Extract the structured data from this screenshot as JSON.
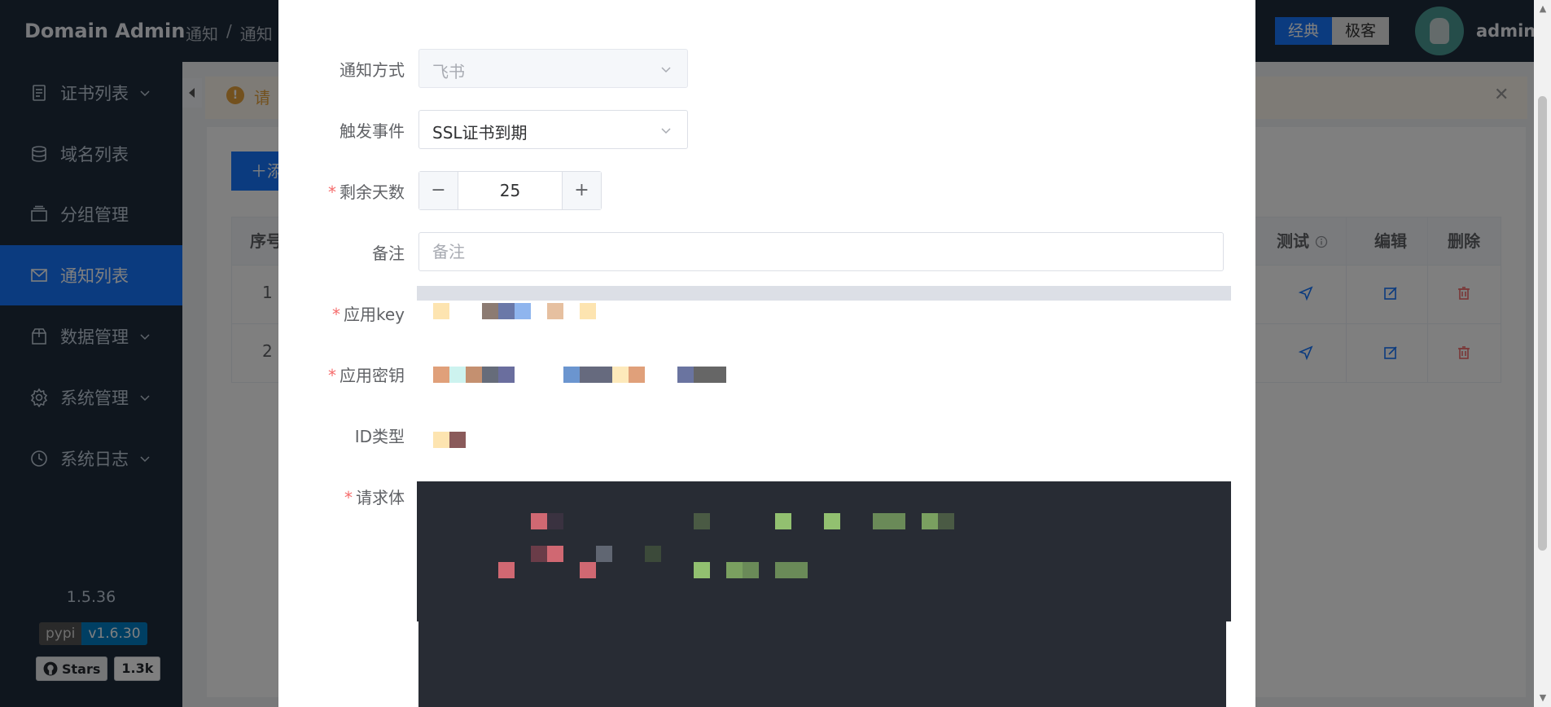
{
  "header": {
    "brand": "Domain Admin",
    "breadcrumb": [
      "通知",
      "/",
      "通知"
    ],
    "modes": [
      "经典",
      "极客"
    ],
    "username": "admin"
  },
  "sidebar": {
    "items": [
      {
        "label": "证书列表",
        "icon": "document-icon",
        "has_children": true
      },
      {
        "label": "域名列表",
        "icon": "database-icon",
        "has_children": false
      },
      {
        "label": "分组管理",
        "icon": "folder-icon",
        "has_children": false
      },
      {
        "label": "通知列表",
        "icon": "mail-icon",
        "has_children": false,
        "active": true
      },
      {
        "label": "数据管理",
        "icon": "box-icon",
        "has_children": true
      },
      {
        "label": "系统管理",
        "icon": "gear-icon",
        "has_children": true
      },
      {
        "label": "系统日志",
        "icon": "clock-icon",
        "has_children": true
      }
    ],
    "version": "1.5.36",
    "pypi_label": "pypi",
    "pypi_version": "v1.6.30",
    "github_label": "Stars",
    "github_count": "1.3k"
  },
  "background": {
    "alert_text": "请",
    "add_button": "＋添",
    "table_headers": {
      "index": "序号",
      "test": "测试",
      "edit": "编辑",
      "delete": "删除"
    },
    "rows": [
      {
        "index": "1"
      },
      {
        "index": "2"
      }
    ]
  },
  "dialog": {
    "fields": {
      "notify_method": {
        "label": "通知方式",
        "value": "飞书"
      },
      "trigger_event": {
        "label": "触发事件",
        "value": "SSL证书到期"
      },
      "remaining_days": {
        "label": "剩余天数",
        "value": "25"
      },
      "remark": {
        "label": "备注",
        "placeholder": "备注"
      },
      "app_key": {
        "label": "应用key"
      },
      "app_secret": {
        "label": "应用密钥"
      },
      "id_type": {
        "label": "ID类型"
      },
      "request_body": {
        "label": "请求体"
      }
    }
  },
  "colors": {
    "primary": "#1677ff",
    "sidebar_bg": "#1f2d3d",
    "required": "#f56c6c",
    "warning": "#e6a23c",
    "danger": "#f56c6c",
    "editor_bg": "#282c34"
  }
}
